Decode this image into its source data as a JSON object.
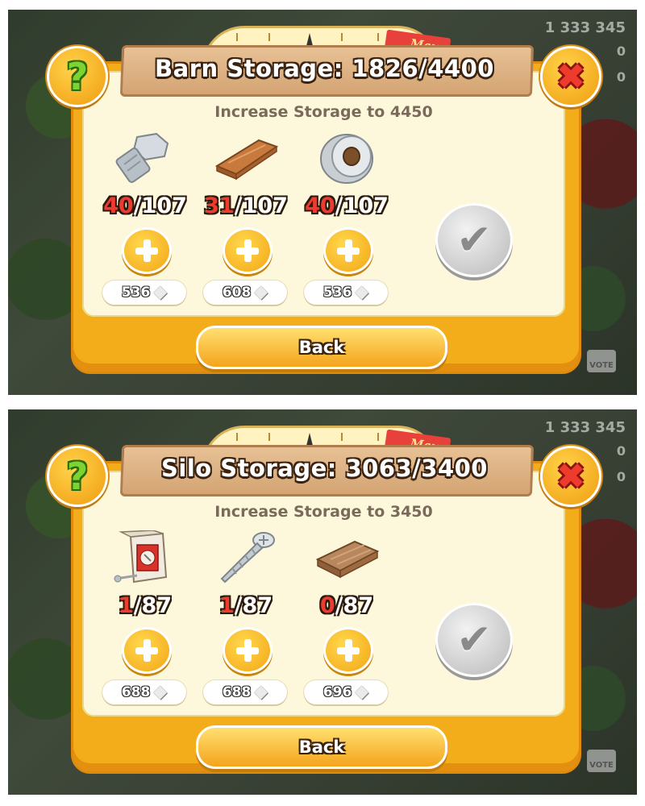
{
  "panels": [
    {
      "title": "Barn Storage: 1826/4400",
      "subtitle": "Increase Storage to 4450",
      "max_label": "Max",
      "back_label": "Back",
      "hud": {
        "coins": "1 333 345",
        "zero1": "0",
        "zero2": "0",
        "vote": "VOTE"
      },
      "items": [
        {
          "name": "Bolt",
          "icon": "bolt-icon",
          "have": "40",
          "need": "/107",
          "price": "536"
        },
        {
          "name": "Plank",
          "icon": "plank-icon",
          "have": "31",
          "need": "/107",
          "price": "608"
        },
        {
          "name": "Duct Tape",
          "icon": "duct-tape-icon",
          "have": "40",
          "need": "/107",
          "price": "536"
        }
      ]
    },
    {
      "title": "Silo Storage: 3063/3400",
      "subtitle": "Increase Storage to 3450",
      "max_label": "Max",
      "back_label": "Back",
      "hud": {
        "coins": "1 333 345",
        "zero1": "0",
        "zero2": "0",
        "vote": "VOTE"
      },
      "items": [
        {
          "name": "Nails",
          "icon": "nails-box-icon",
          "have": "1",
          "need": "/87",
          "price": "688"
        },
        {
          "name": "Screw",
          "icon": "screw-icon",
          "have": "1",
          "need": "/87",
          "price": "688"
        },
        {
          "name": "Wood Panel",
          "icon": "wood-panel-icon",
          "have": "0",
          "need": "/87",
          "price": "696"
        }
      ]
    }
  ],
  "colors": {
    "frame": "#f3ad1a",
    "inner": "#fdf8dc",
    "red_count": "#ef3a2e",
    "banner": "#d4a473"
  }
}
